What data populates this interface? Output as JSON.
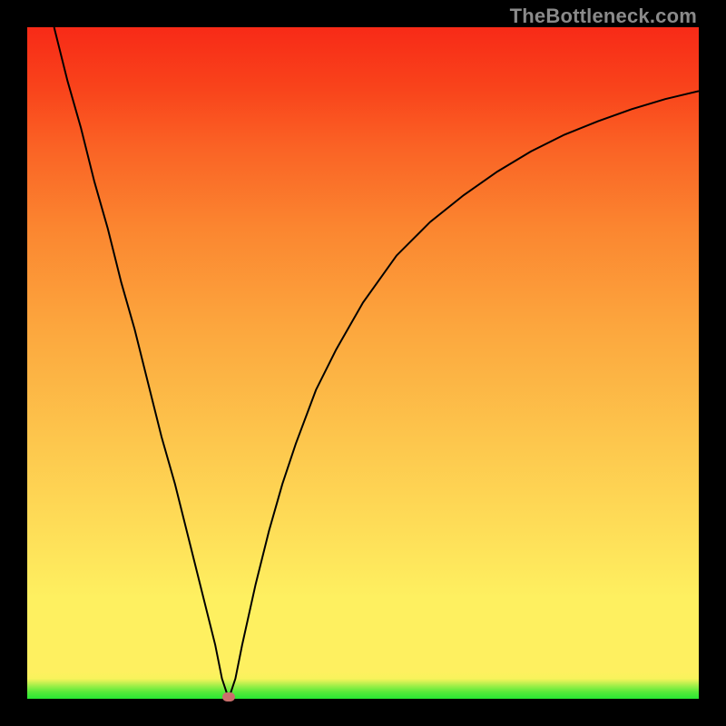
{
  "watermark": "TheBottleneck.com",
  "chart_data": {
    "type": "line",
    "title": "",
    "xlabel": "",
    "ylabel": "",
    "xlim": [
      0,
      100
    ],
    "ylim": [
      0,
      100
    ],
    "grid": false,
    "legend": false,
    "annotations": [
      {
        "name": "min-point-marker",
        "x": 30,
        "y": 0
      }
    ],
    "series": [
      {
        "name": "bottleneck-curve",
        "x": [
          4,
          6,
          8,
          10,
          12,
          14,
          16,
          18,
          20,
          22,
          24,
          26,
          28,
          29,
          30,
          31,
          32,
          34,
          36,
          38,
          40,
          43,
          46,
          50,
          55,
          60,
          65,
          70,
          75,
          80,
          85,
          90,
          95,
          100
        ],
        "y": [
          100,
          92,
          85,
          77,
          70,
          62,
          55,
          47,
          39,
          32,
          24,
          16,
          8,
          3,
          0,
          3,
          8,
          17,
          25,
          32,
          38,
          46,
          52,
          59,
          66,
          71,
          75,
          78.5,
          81.5,
          84,
          86,
          87.8,
          89.3,
          90.5
        ]
      }
    ],
    "background_gradient": {
      "stops": [
        {
          "pct": 0,
          "color": "#27e833"
        },
        {
          "pct": 3,
          "color": "#f8f35c"
        },
        {
          "pct": 15,
          "color": "#fef060"
        },
        {
          "pct": 55,
          "color": "#fca73e"
        },
        {
          "pct": 100,
          "color": "#f82a17"
        }
      ]
    }
  }
}
